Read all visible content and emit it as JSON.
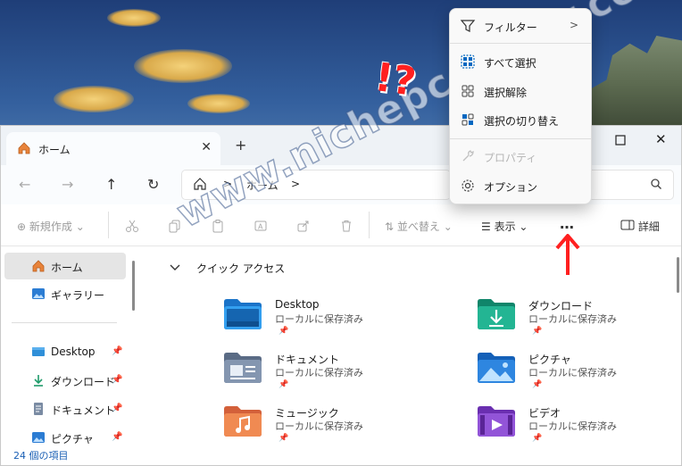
{
  "window": {
    "tab_label": "ホーム",
    "tab_close": "✕",
    "new_tab": "+",
    "minimize": "—",
    "maximize": "☐",
    "close": "✕"
  },
  "nav": {
    "back": "←",
    "forward": "→",
    "up": "↑",
    "refresh": "↻",
    "address_segments": [
      "ホーム"
    ],
    "separator": ">"
  },
  "toolbar": {
    "new_label": "新規作成",
    "sort_label": "並べ替え",
    "view_label": "表示",
    "more_label": "…",
    "details_label": "詳細"
  },
  "sidebar": {
    "items": [
      {
        "label": "ホーム",
        "icon": "home-icon",
        "selected": true
      },
      {
        "label": "ギャラリー",
        "icon": "gallery-icon"
      },
      {
        "label": "Desktop",
        "icon": "desktop-folder-icon",
        "pinned": true
      },
      {
        "label": "ダウンロード",
        "icon": "download-icon",
        "pinned": true
      },
      {
        "label": "ドキュメント",
        "icon": "document-icon",
        "pinned": true
      },
      {
        "label": "ピクチャ",
        "icon": "pictures-icon",
        "pinned": true
      }
    ]
  },
  "main": {
    "section_title": "クイック アクセス",
    "items": [
      {
        "name": "Desktop",
        "sub": "ローカルに保存済み",
        "icon": "desktop-folder-icon"
      },
      {
        "name": "ダウンロード",
        "sub": "ローカルに保存済み",
        "icon": "downloads-folder-icon"
      },
      {
        "name": "ドキュメント",
        "sub": "ローカルに保存済み",
        "icon": "documents-folder-icon"
      },
      {
        "name": "ピクチャ",
        "sub": "ローカルに保存済み",
        "icon": "pictures-folder-icon"
      },
      {
        "name": "ミュージック",
        "sub": "ローカルに保存済み",
        "icon": "music-folder-icon"
      },
      {
        "name": "ビデオ",
        "sub": "ローカルに保存済み",
        "icon": "videos-folder-icon"
      }
    ]
  },
  "status": {
    "text": "24 個の項目"
  },
  "menu": {
    "items": [
      {
        "label": "フィルター",
        "icon": "filter-icon",
        "submenu": true
      },
      {
        "label": "すべて選択",
        "icon": "select-all-icon"
      },
      {
        "label": "選択解除",
        "icon": "select-none-icon"
      },
      {
        "label": "選択の切り替え",
        "icon": "invert-selection-icon"
      },
      {
        "label": "プロパティ",
        "icon": "properties-icon",
        "disabled": true
      },
      {
        "label": "オプション",
        "icon": "options-gear-icon"
      }
    ],
    "submenu_arrow": ">"
  },
  "annotations": {
    "exclaim": "!?",
    "watermark": "www.nichepcgamer.com"
  },
  "colors": {
    "accent": "#0067c0",
    "annotation_red": "#ff2020"
  }
}
